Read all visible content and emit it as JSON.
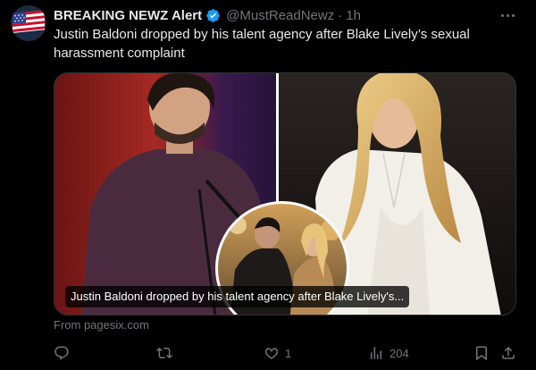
{
  "tweet": {
    "display_name": "BREAKING NEWZ Alert",
    "handle": "@MustReadNewz",
    "separator": "·",
    "time": "1h",
    "text": "Justin Baldoni dropped by his talent agency after Blake Lively’s sexual harassment complaint",
    "avatar_icon": "us-flag-icon",
    "verified_icon": "verified-badge-icon",
    "verified_color": "#1d9bf0"
  },
  "card": {
    "title": "Justin Baldoni dropped by his talent agency after Blake Lively's...",
    "source": "From pagesix.com"
  },
  "actions": {
    "reply_icon": "reply-icon",
    "reply_count": "",
    "retweet_icon": "retweet-icon",
    "retweet_count": "",
    "like_icon": "heart-icon",
    "like_count": "1",
    "views_icon": "views-chart-icon",
    "views_count": "204",
    "bookmark_icon": "bookmark-icon",
    "share_icon": "share-icon"
  },
  "colors": {
    "background": "#000000",
    "text": "#e7e9ea",
    "muted": "#71767b",
    "accent": "#1d9bf0"
  }
}
